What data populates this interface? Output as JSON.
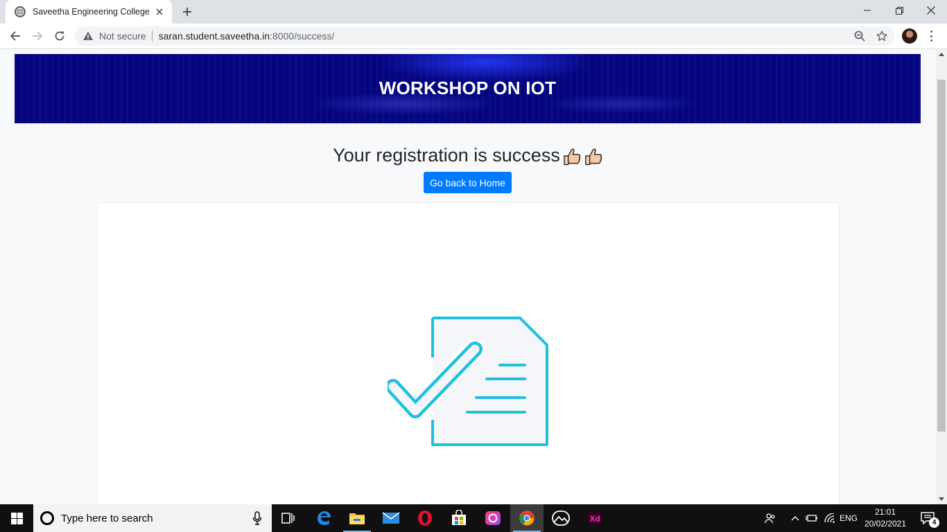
{
  "browser": {
    "tab_title": "Saveetha Engineering College",
    "security_label": "Not secure",
    "url_host": "saran.student.saveetha.in",
    "url_rest": ":8000/success/"
  },
  "page": {
    "banner_title": "WORKSHOP ON IOT",
    "success_message": "Your registration is success",
    "home_button": "Go back to Home",
    "accent_color": "#007bff",
    "banner_color": "#050580",
    "illustration_color": "#1ec0e0"
  },
  "taskbar": {
    "search_placeholder": "Type here to search",
    "apps": [
      "task-view-icon",
      "edge-icon",
      "file-explorer-icon",
      "mail-icon",
      "opera-icon",
      "store-icon",
      "creative-cloud-icon",
      "chrome-icon",
      "photos-icon",
      "adobe-xd-icon"
    ],
    "xd_label": "Xd",
    "language": "ENG",
    "time": "21:01",
    "date": "20/02/2021",
    "notification_count": "4"
  }
}
